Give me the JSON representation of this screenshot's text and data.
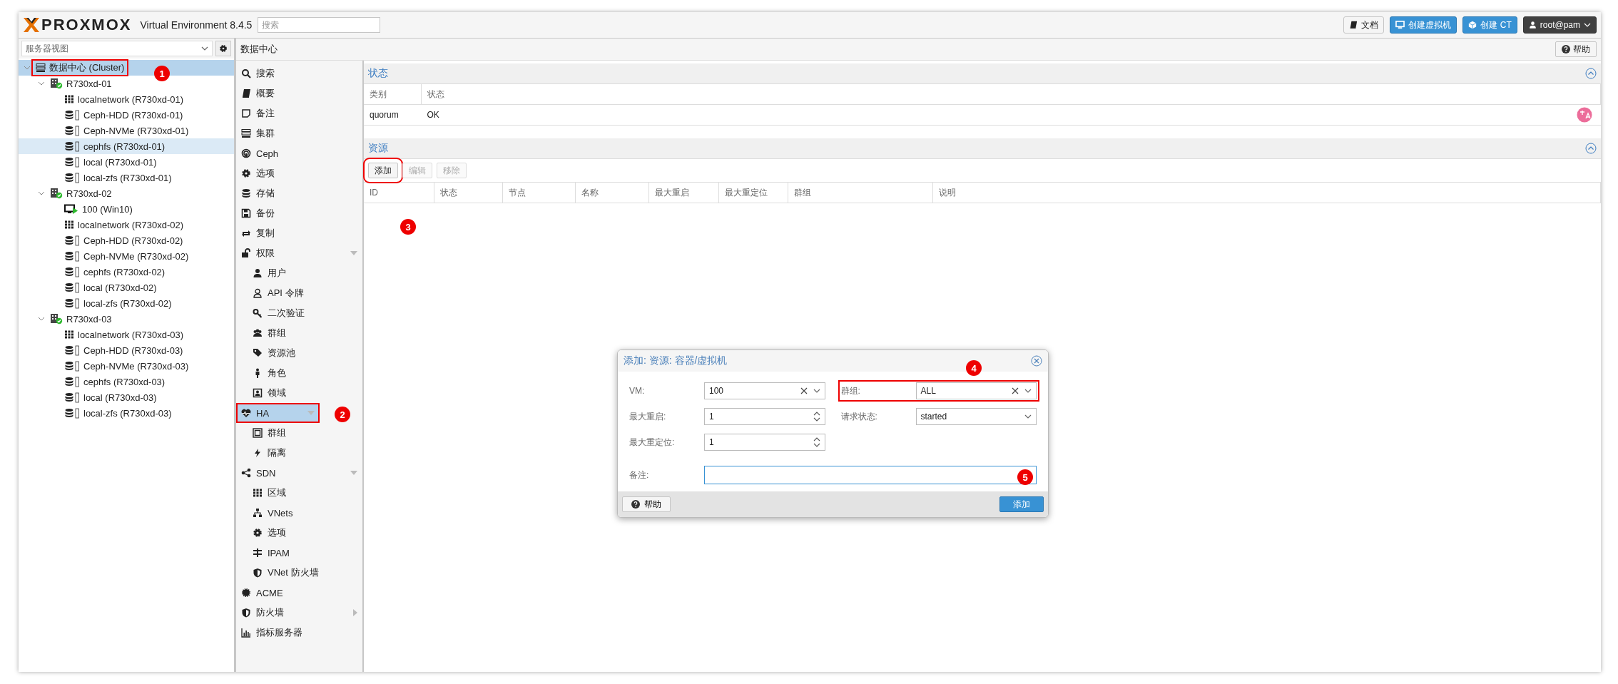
{
  "topbar": {
    "logo": "PROXMOX",
    "product": "Virtual Environment 8.4.5",
    "search": {
      "placeholder": "搜索"
    },
    "buttons": [
      {
        "label": "文档",
        "kind": "docs"
      },
      {
        "label": "创建虚拟机",
        "kind": "create-vm"
      },
      {
        "label": "创建 CT",
        "kind": "create-ct"
      },
      {
        "label": "root@pam",
        "kind": "user"
      }
    ]
  },
  "sidebar": {
    "view_select": {
      "value": "服务器视图"
    },
    "tree": {
      "label": "数据中心 (Cluster)",
      "kind": "datacenter",
      "selected": true,
      "hovered": false,
      "marked": true,
      "expanded": true,
      "children": [
        {
          "label": "R730xd-01",
          "kind": "node",
          "selected": false,
          "hovered": false,
          "marked": false,
          "expanded": true,
          "children": [
            {
              "label": "localnetwork (R730xd-01)",
              "kind": "network",
              "selected": false,
              "hovered": false,
              "marked": false
            },
            {
              "label": "Ceph-HDD (R730xd-01)",
              "kind": "storage",
              "selected": false,
              "hovered": false,
              "marked": false
            },
            {
              "label": "Ceph-NVMe (R730xd-01)",
              "kind": "storage",
              "selected": false,
              "hovered": false,
              "marked": false
            },
            {
              "label": "cephfs (R730xd-01)",
              "kind": "storage",
              "selected": false,
              "hovered": true,
              "marked": false
            },
            {
              "label": "local (R730xd-01)",
              "kind": "storage",
              "selected": false,
              "hovered": false,
              "marked": false
            },
            {
              "label": "local-zfs (R730xd-01)",
              "kind": "storage",
              "selected": false,
              "hovered": false,
              "marked": false
            }
          ]
        },
        {
          "label": "R730xd-02",
          "kind": "node",
          "selected": false,
          "hovered": false,
          "marked": false,
          "expanded": true,
          "children": [
            {
              "label": "100 (Win10)",
              "kind": "vm",
              "selected": false,
              "hovered": false,
              "marked": false
            },
            {
              "label": "localnetwork (R730xd-02)",
              "kind": "network",
              "selected": false,
              "hovered": false,
              "marked": false
            },
            {
              "label": "Ceph-HDD (R730xd-02)",
              "kind": "storage",
              "selected": false,
              "hovered": false,
              "marked": false
            },
            {
              "label": "Ceph-NVMe (R730xd-02)",
              "kind": "storage",
              "selected": false,
              "hovered": false,
              "marked": false
            },
            {
              "label": "cephfs (R730xd-02)",
              "kind": "storage",
              "selected": false,
              "hovered": false,
              "marked": false
            },
            {
              "label": "local (R730xd-02)",
              "kind": "storage",
              "selected": false,
              "hovered": false,
              "marked": false
            },
            {
              "label": "local-zfs (R730xd-02)",
              "kind": "storage",
              "selected": false,
              "hovered": false,
              "marked": false
            }
          ]
        },
        {
          "label": "R730xd-03",
          "kind": "node",
          "selected": false,
          "hovered": false,
          "marked": false,
          "expanded": true,
          "children": [
            {
              "label": "localnetwork (R730xd-03)",
              "kind": "network",
              "selected": false,
              "hovered": false,
              "marked": false
            },
            {
              "label": "Ceph-HDD (R730xd-03)",
              "kind": "storage",
              "selected": false,
              "hovered": false,
              "marked": false
            },
            {
              "label": "Ceph-NVMe (R730xd-03)",
              "kind": "storage",
              "selected": false,
              "hovered": false,
              "marked": false
            },
            {
              "label": "cephfs (R730xd-03)",
              "kind": "storage",
              "selected": false,
              "hovered": false,
              "marked": false
            },
            {
              "label": "local (R730xd-03)",
              "kind": "storage",
              "selected": false,
              "hovered": false,
              "marked": false
            },
            {
              "label": "local-zfs (R730xd-03)",
              "kind": "storage",
              "selected": false,
              "hovered": false,
              "marked": false
            }
          ]
        }
      ]
    }
  },
  "content": {
    "title": "数据中心",
    "help_button": "帮助",
    "nav": [
      {
        "label": "搜索",
        "selected": false,
        "marked": false
      },
      {
        "label": "概要",
        "selected": false,
        "marked": false
      },
      {
        "label": "备注",
        "selected": false,
        "marked": false
      },
      {
        "label": "集群",
        "selected": false,
        "marked": false
      },
      {
        "label": "Ceph",
        "selected": false,
        "marked": false
      },
      {
        "label": "选项",
        "selected": false,
        "marked": false
      },
      {
        "label": "存储",
        "selected": false,
        "marked": false
      },
      {
        "label": "备份",
        "selected": false,
        "marked": false
      },
      {
        "label": "复制",
        "selected": false,
        "marked": false
      },
      {
        "label": "权限",
        "selected": false,
        "marked": false,
        "expanded": true,
        "children": [
          {
            "label": "用户",
            "selected": false,
            "marked": false
          },
          {
            "label": "API 令牌",
            "selected": false,
            "marked": false
          },
          {
            "label": "二次验证",
            "selected": false,
            "marked": false
          },
          {
            "label": "群组",
            "selected": false,
            "marked": false
          },
          {
            "label": "资源池",
            "selected": false,
            "marked": false
          },
          {
            "label": "角色",
            "selected": false,
            "marked": false
          },
          {
            "label": "领域",
            "selected": false,
            "marked": false
          }
        ]
      },
      {
        "label": "HA",
        "selected": true,
        "marked": true,
        "expanded": true,
        "children": [
          {
            "label": "群组",
            "selected": false,
            "marked": false
          },
          {
            "label": "隔离",
            "selected": false,
            "marked": false
          }
        ]
      },
      {
        "label": "SDN",
        "selected": false,
        "marked": false,
        "expanded": true,
        "children": [
          {
            "label": "区域",
            "selected": false,
            "marked": false
          },
          {
            "label": "VNets",
            "selected": false,
            "marked": false
          },
          {
            "label": "选项",
            "selected": false,
            "marked": false
          },
          {
            "label": "IPAM",
            "selected": false,
            "marked": false
          },
          {
            "label": "VNet 防火墙",
            "selected": false,
            "marked": false
          }
        ]
      },
      {
        "label": "ACME",
        "selected": false,
        "marked": false
      },
      {
        "label": "防火墙",
        "selected": false,
        "marked": false,
        "expanded": false
      },
      {
        "label": "指标服务器",
        "selected": false,
        "marked": false
      }
    ],
    "status_panel": {
      "title": "状态",
      "columns": [
        "类别",
        "状态"
      ],
      "rows": [
        [
          "quorum",
          "OK"
        ]
      ]
    },
    "resources_panel": {
      "title": "资源",
      "toolbar": [
        {
          "label": "添加",
          "disabled": false,
          "marked": true
        },
        {
          "label": "编辑",
          "disabled": true,
          "marked": false
        },
        {
          "label": "移除",
          "disabled": true,
          "marked": false
        }
      ],
      "columns": [
        "ID",
        "状态",
        "节点",
        "名称",
        "最大重启",
        "最大重定位",
        "群组",
        "说明"
      ]
    }
  },
  "dialog": {
    "title": "添加: 资源: 容器/虚拟机",
    "left_fields": [
      {
        "label": "VM:",
        "value": "100",
        "kind": "combo",
        "marked": false
      },
      {
        "label": "最大重启:",
        "value": "1",
        "kind": "spinner",
        "marked": false
      },
      {
        "label": "最大重定位:",
        "value": "1",
        "kind": "spinner",
        "marked": false
      }
    ],
    "right_fields": [
      {
        "label": "群组:",
        "value": "ALL",
        "kind": "combo",
        "marked": true
      },
      {
        "label": "请求状态:",
        "value": "started",
        "kind": "select",
        "marked": false
      }
    ],
    "comment": {
      "label": "备注:"
    },
    "help_button": "帮助",
    "submit_button": "添加"
  },
  "annotations": [
    {
      "number": "1"
    },
    {
      "number": "2"
    },
    {
      "number": "3"
    },
    {
      "number": "4"
    },
    {
      "number": "5"
    }
  ]
}
